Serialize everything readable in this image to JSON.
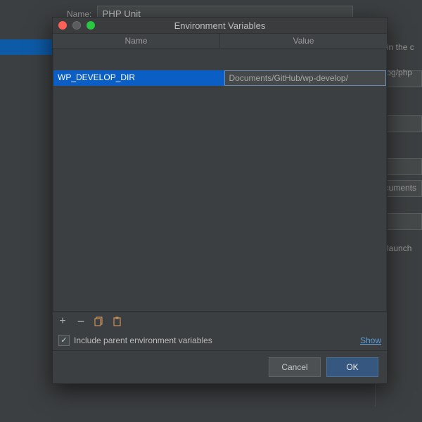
{
  "background": {
    "name_label": "Name:",
    "name_value": "PHP Unit",
    "right_hints": {
      "line1": "d in the c",
      "line2": "blog/php",
      "line3": "ocuments",
      "line4": "e launch"
    }
  },
  "dialog": {
    "title": "Environment Variables",
    "columns": {
      "name": "Name",
      "value": "Value"
    },
    "row": {
      "name": "WP_DEVELOP_DIR",
      "value": "Documents/GitHub/wp-develop/"
    },
    "toolbar": {
      "add": "+",
      "remove": "−"
    },
    "include_label": "Include parent environment variables",
    "show_link": "Show",
    "buttons": {
      "cancel": "Cancel",
      "ok": "OK"
    }
  }
}
